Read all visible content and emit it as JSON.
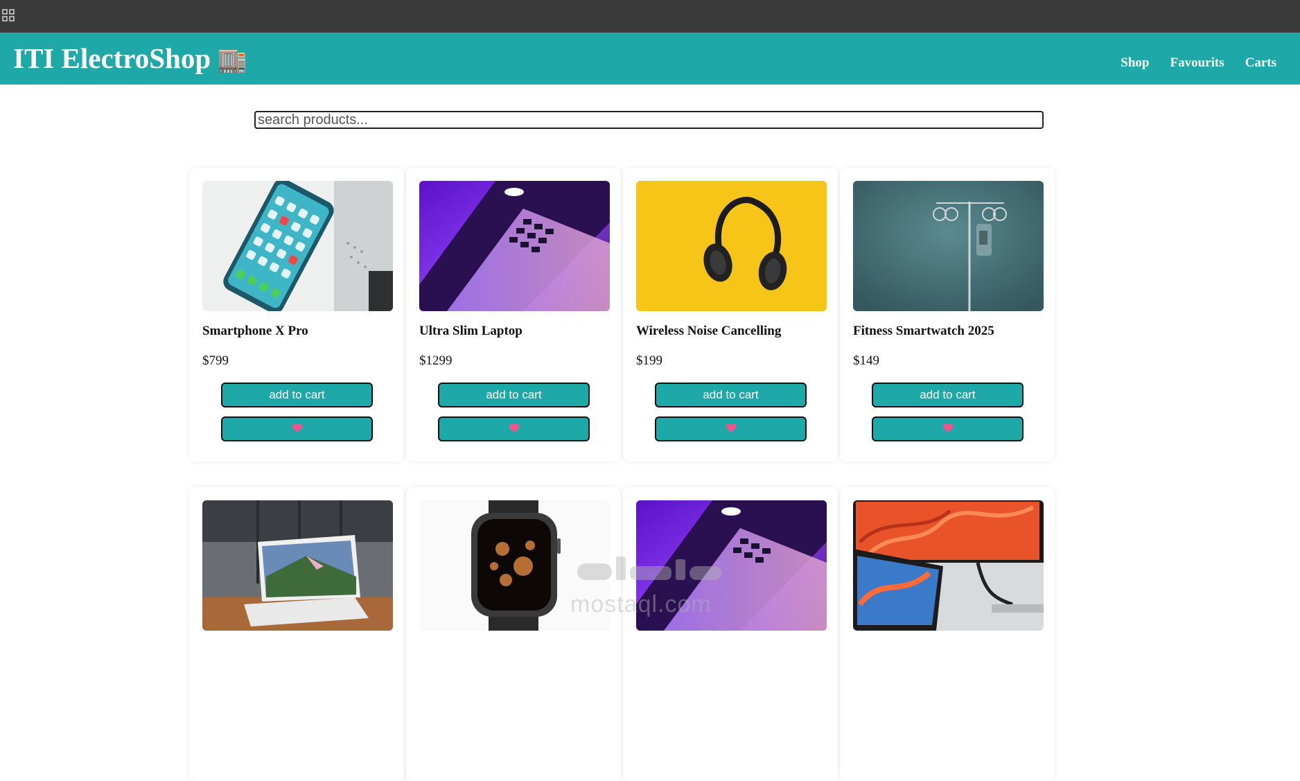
{
  "header": {
    "brand": "ITI ElectroShop",
    "brand_emoji": "🏬",
    "nav": [
      {
        "label": "Shop"
      },
      {
        "label": "Favourits"
      },
      {
        "label": "Carts"
      }
    ]
  },
  "search": {
    "placeholder": "search products...",
    "value": ""
  },
  "products": [
    {
      "name": "Smartphone X Pro",
      "price": "$799",
      "image": "smartphone-photo",
      "cart_label": "add to cart",
      "fav_icon": "heart-icon"
    },
    {
      "name": "Ultra Slim Laptop",
      "price": "$1299",
      "image": "laptop-photo",
      "cart_label": "add to cart",
      "fav_icon": "heart-icon"
    },
    {
      "name": "Wireless Noise Cancelling",
      "price": "$199",
      "image": "headphones-photo",
      "cart_label": "add to cart",
      "fav_icon": "heart-icon"
    },
    {
      "name": "Fitness Smartwatch 2025",
      "price": "$149",
      "image": "iv-stand-photo",
      "cart_label": "add to cart",
      "fav_icon": "heart-icon"
    },
    {
      "name": "",
      "price": "",
      "image": "laptop-landscape-photo"
    },
    {
      "name": "",
      "price": "",
      "image": "smartwatch-photo"
    },
    {
      "name": "",
      "price": "",
      "image": "laptop-photo"
    },
    {
      "name": "",
      "price": "",
      "image": "monitor-laptop-photo"
    }
  ],
  "watermark": {
    "text": "mostaql.com",
    "arabic": "مستقل"
  },
  "colors": {
    "accent": "#1ea8a8",
    "topbar": "#3a3a3a",
    "heart": "#ff4f8b"
  }
}
